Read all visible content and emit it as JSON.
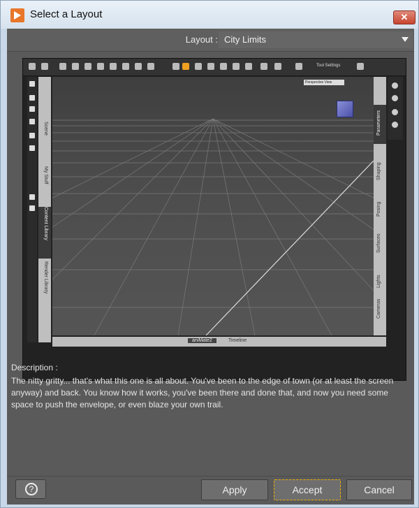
{
  "window": {
    "title": "Select a Layout",
    "close_label": "✕"
  },
  "layout": {
    "label": "Layout :",
    "value": "City Limits"
  },
  "preview": {
    "left_tabs": [
      "Scene",
      "My Stuff",
      "Content Library",
      "Render Library"
    ],
    "left_active": "Content Library",
    "right_tabs": [
      "Parameters",
      "Shaping",
      "Posing",
      "Surfaces",
      "Lights",
      "Cameras"
    ],
    "right_active": "Parameters",
    "bottom_tabs": [
      "aniMate2",
      "Timeline"
    ],
    "bottom_active": "aniMate2",
    "perspective_label": "Perspective View",
    "tool_settings": "Tool Settings",
    "colors": {
      "highlight": "#f0a020"
    }
  },
  "description": {
    "title": "Description :",
    "text": "The nitty gritty... that's what this one is all about. You've been to the edge of town (or at least the screen anyway) and back. You know how it works, you've been there and done that, and now you need some space to push the envelope, or even blaze your own trail."
  },
  "buttons": {
    "help": "?",
    "apply": "Apply",
    "accept": "Accept",
    "cancel": "Cancel"
  }
}
